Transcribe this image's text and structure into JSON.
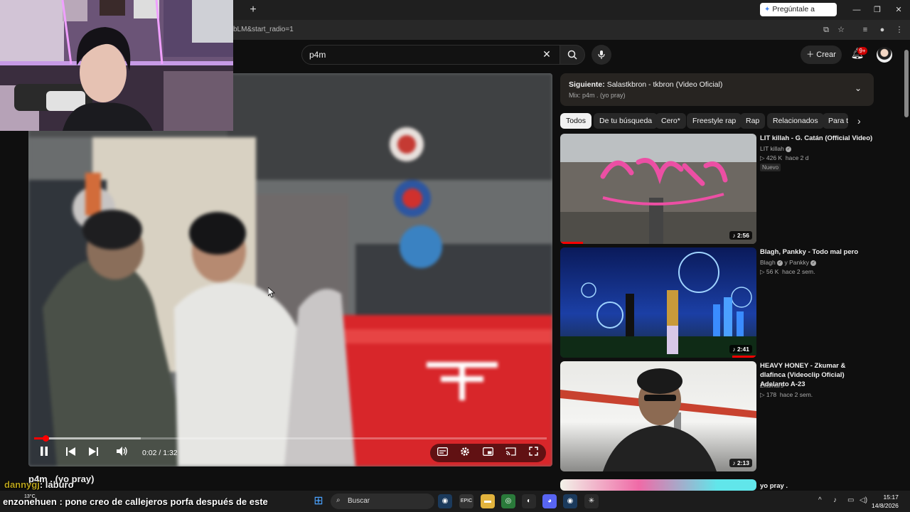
{
  "browser": {
    "new_tab": "+",
    "tab_close": "×",
    "gemini_label": "Pregúntale a Gemini",
    "url": "bLM&start_radio=1",
    "window_min": "—",
    "window_max": "❐",
    "window_close": "✕"
  },
  "youtube": {
    "search_query": "p4m",
    "create_label": "Crear",
    "notifications_badge": "9+"
  },
  "player": {
    "timecode": "0:02 / 1:32",
    "progress_fraction": 0.022
  },
  "video_title": "p4m . (yo pray)",
  "up_next": {
    "label": "Siguiente:",
    "title": "Salastkbron - tkbron (Video Oficial)",
    "subtitle": "Mix: p4m . (yo pray)"
  },
  "chips": [
    "Todos",
    "De tu búsqueda",
    "Cero*",
    "Freestyle rap",
    "Rap",
    "Relacionados",
    "Para ti"
  ],
  "recommendations": [
    {
      "title": "LIT killah - G. Catán (Official Video)",
      "channel": "LIT killah",
      "views": "426 K",
      "age": "hace 2 d",
      "badge": "Nuevo",
      "duration": "2:56",
      "thumb_text": "GCATAN"
    },
    {
      "title": "Blagh, Pankky - Todo mal pero",
      "channel": "Blagh",
      "channel2": "y Pankky",
      "views": "56 K",
      "age": "hace 2 sem.",
      "duration": "2:41"
    },
    {
      "title": "HEAVY HONEY - Zkumar & dlafinca (Videoclip Oficial) Adelanto A-23",
      "channel": "Zkumar9",
      "views": "178",
      "age": "hace 2 sem.",
      "duration": "2:13"
    },
    {
      "title": "yo pray ."
    }
  ],
  "chat": {
    "line1_user": "dannygj",
    "line1_msg": ": laburo",
    "line2": "enzonehuen : pone creo de callejeros porfa después de este"
  },
  "taskbar": {
    "search_label": "Buscar",
    "weather": "13°C",
    "time": "15:17",
    "date": "14/8/2026"
  }
}
